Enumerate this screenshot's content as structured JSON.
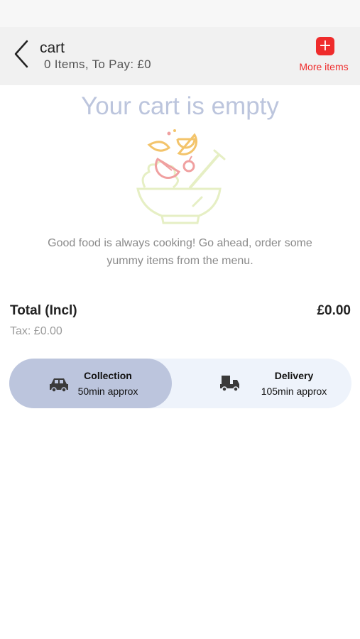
{
  "header": {
    "title": "cart",
    "subtitle": "0 Items, To Pay: £0",
    "more_label": "More items",
    "more_icon": "plus-icon",
    "back_icon": "chevron-left-icon",
    "accent_color": "#ef2c2c"
  },
  "empty": {
    "title": "Your cart is empty",
    "message": "Good food is always cooking! Go ahead, order some yummy items from the menu.",
    "illustration": "salad-bowl-illustration"
  },
  "totals": {
    "label": "Total (Incl)",
    "value": "£0.00",
    "tax": "Tax: £0.00"
  },
  "fulfilment": {
    "selected": "collection",
    "options": [
      {
        "id": "collection",
        "name": "Collection",
        "time": "50min approx",
        "icon": "car-icon"
      },
      {
        "id": "delivery",
        "name": "Delivery",
        "time": "105min approx",
        "icon": "delivery-truck-icon"
      }
    ],
    "selected_color": "#bcc5dd"
  }
}
